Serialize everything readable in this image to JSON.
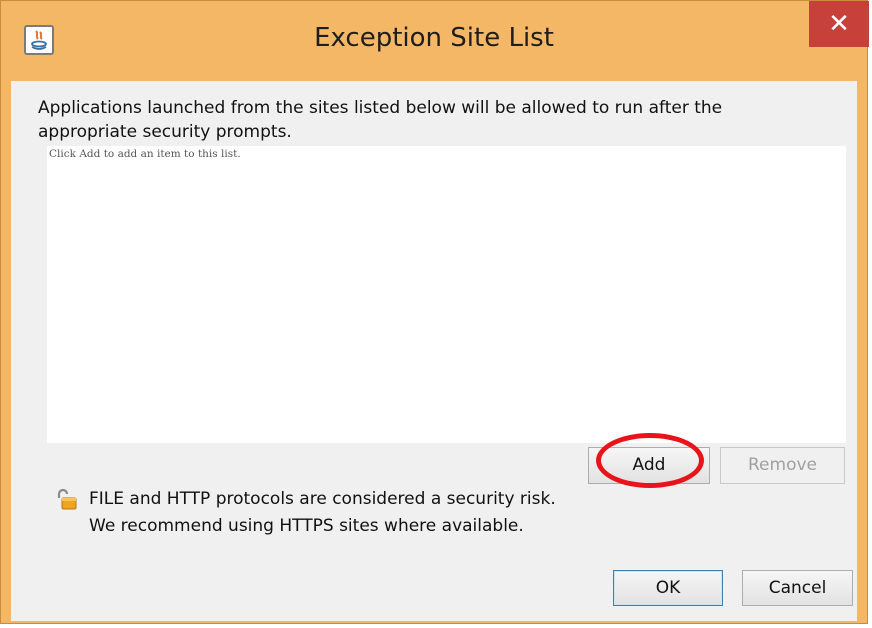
{
  "window": {
    "title": "Exception Site List",
    "close_label": "✕",
    "app_icon": "java-icon"
  },
  "intro": {
    "line1": "Applications launched from the sites listed below will be allowed to run after the",
    "line2": "appropriate security prompts."
  },
  "site_list": {
    "empty_hint": "Click Add to add an item to this list."
  },
  "buttons": {
    "add": "Add",
    "remove": "Remove",
    "ok": "OK",
    "cancel": "Cancel"
  },
  "warning": {
    "icon": "unlocked-padlock-icon",
    "line1": "FILE and HTTP protocols are considered a security risk.",
    "line2": "We recommend using HTTPS sites where available."
  },
  "annotation": {
    "color": "#e8131b",
    "target": "add-button"
  },
  "colors": {
    "title_bar": "#f4b766",
    "close_button": "#c7403a",
    "dialog_body": "#f0f0f0"
  }
}
